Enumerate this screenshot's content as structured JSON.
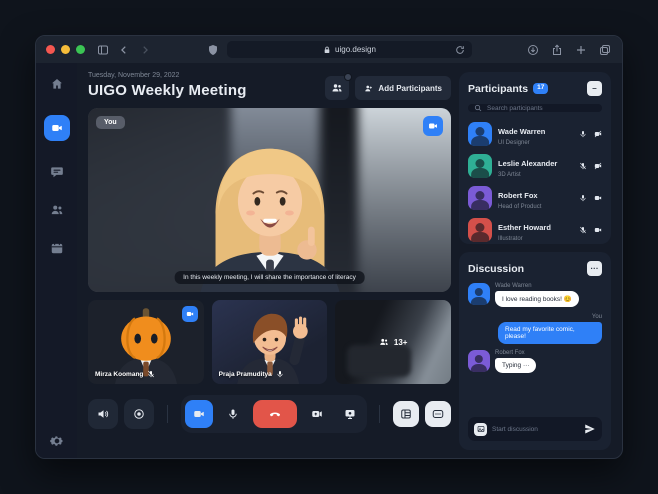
{
  "colors": {
    "outer": "#0F141C",
    "chrome": "#1D2430",
    "app": "#151B27",
    "panel": "#1A2231",
    "item": "#222A39",
    "input": "#121826",
    "accent": "#2F80F7",
    "danger": "#E25549",
    "traffic_red": "#F55750",
    "traffic_yellow": "#F6BD3A",
    "traffic_green": "#3BC554"
  },
  "browser": {
    "url": "uigo.design"
  },
  "sidebar": {
    "items": [
      "home",
      "meetings",
      "chat",
      "contacts",
      "calendar"
    ],
    "bottom": "settings"
  },
  "header": {
    "date": "Tuesday, November 29, 2022",
    "title": "UIGO Weekly Meeting",
    "add_participants_label": "Add Participants"
  },
  "stage": {
    "you_label": "You",
    "caption": "In this weekly meeting, I will share the importance of literacy"
  },
  "thumbnails": {
    "items": [
      {
        "name": "Mirza Koomang",
        "mic": "off"
      },
      {
        "name": "Praja Pramuditya",
        "mic": "on"
      }
    ],
    "overflow_label": "13+"
  },
  "controls": {
    "buttons": [
      "speaker",
      "record",
      "camera-active",
      "microphone",
      "end-call",
      "screen-share",
      "present",
      "layout",
      "more"
    ]
  },
  "participants": {
    "title": "Participants",
    "count": "17",
    "collapse_glyph": "–",
    "search_placeholder": "Search participants",
    "list": [
      {
        "name": "Wade Warren",
        "role": "UI Designer",
        "mic": "on",
        "camera": "off",
        "avatar_color": "#2F80F7"
      },
      {
        "name": "Leslie Alexander",
        "role": "3D Artist",
        "mic": "off",
        "camera": "off",
        "avatar_color": "#2FAF95"
      },
      {
        "name": "Robert Fox",
        "role": "Head of Product",
        "mic": "on",
        "camera": "on",
        "avatar_color": "#7B5BD6"
      },
      {
        "name": "Esther Howard",
        "role": "Illustrator",
        "mic": "off",
        "camera": "on",
        "avatar_color": "#D4504A"
      }
    ]
  },
  "discussion": {
    "title": "Discussion",
    "menu_glyph": "···",
    "you_label": "You",
    "messages": [
      {
        "sender": "Wade Warren",
        "text": "I love reading books! 😊"
      },
      {
        "sender": "You",
        "text": "Read my favorite comic, please!"
      },
      {
        "sender": "Robert Fox",
        "text": "Typing ···"
      }
    ],
    "input_placeholder": "Start discussion"
  }
}
